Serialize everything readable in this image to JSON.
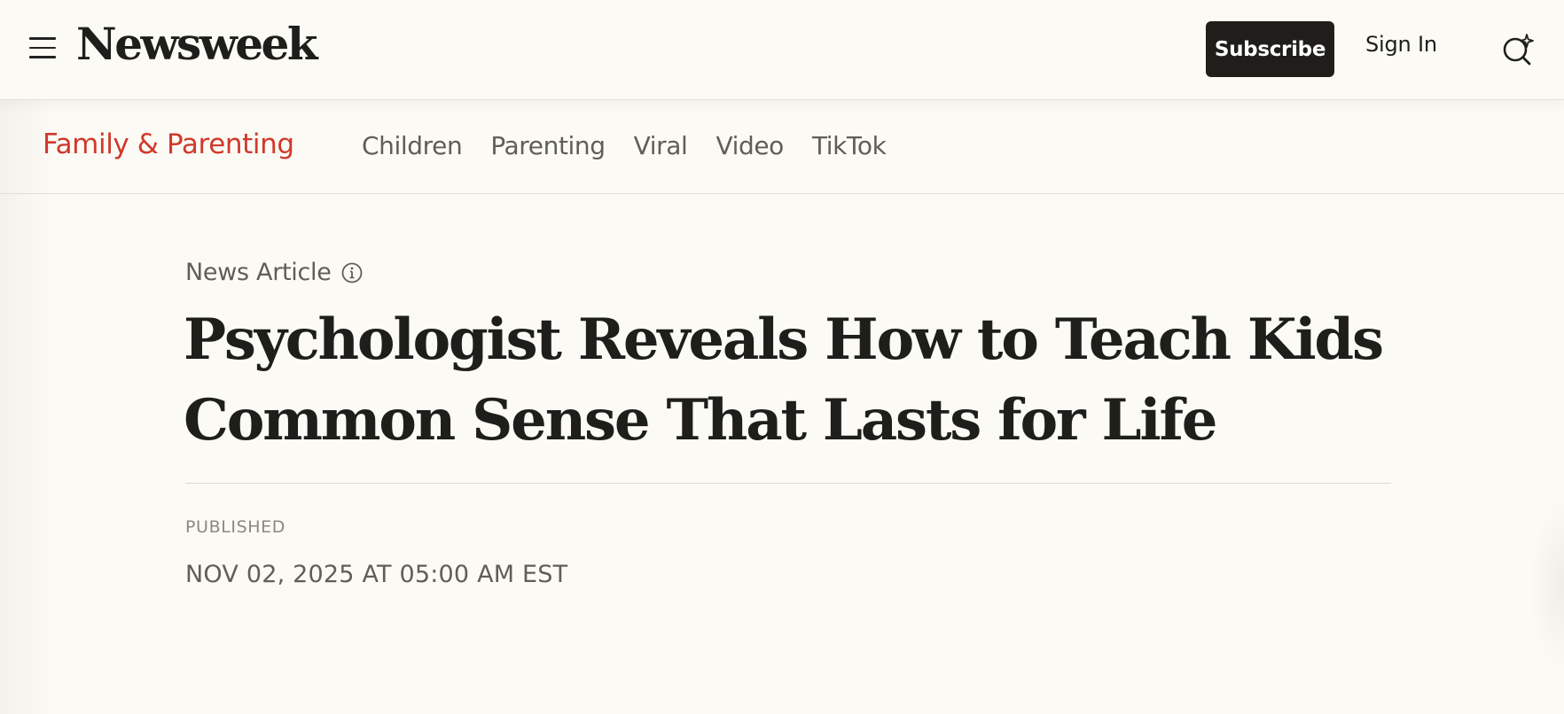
{
  "header": {
    "logo": "Newsweek",
    "subscribe_label": "Subscribe",
    "signin_label": "Sign In",
    "menu_icon": "hamburger-menu-icon",
    "search_icon": "ai-search-icon"
  },
  "section_nav": {
    "title": "Family & Parenting",
    "links": [
      {
        "label": "Children"
      },
      {
        "label": "Parenting"
      },
      {
        "label": "Viral"
      },
      {
        "label": "Video"
      },
      {
        "label": "TikTok"
      }
    ]
  },
  "article": {
    "type_label": "News Article",
    "type_info_icon": "info-icon",
    "headline_line1": "Psychologist Reveals How to Teach Kids",
    "headline_line2": "Common Sense That Lasts for Life",
    "published_label": "PUBLISHED",
    "published_date": "NOV 02, 2025 AT 05:00 AM EST"
  },
  "colors": {
    "background": "#fbfaf5",
    "section_accent": "#d0392b",
    "subscribe_bg": "#1f1e1b",
    "text_primary": "#1e1e1a",
    "text_secondary": "#5f5e58",
    "text_muted": "#8a897f"
  }
}
